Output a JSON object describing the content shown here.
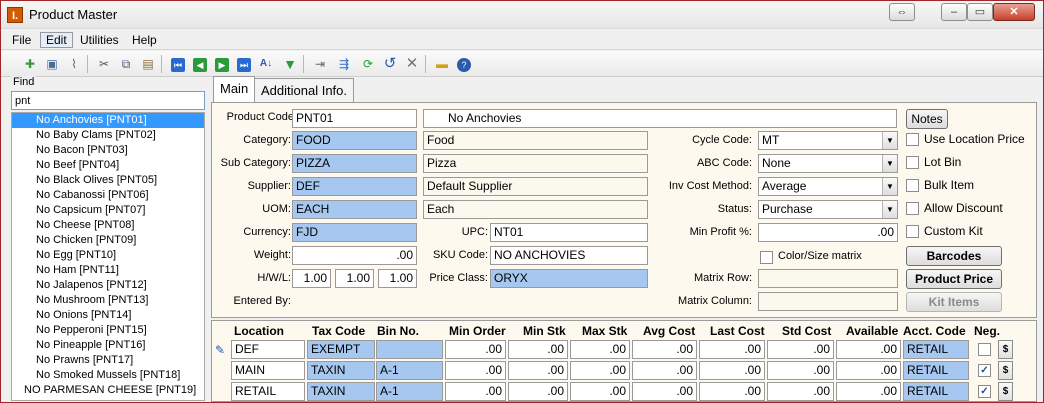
{
  "window": {
    "title": "Product Master",
    "app_icon": "I."
  },
  "menu": [
    "File",
    "Edit",
    "Utilities",
    "Help"
  ],
  "find": {
    "label": "Find",
    "query": "pnt",
    "items": [
      "No Anchovies [PNT01]",
      "No Baby Clams [PNT02]",
      "No Bacon [PNT03]",
      "No Beef [PNT04]",
      "No Black Olives [PNT05]",
      "No Cabanossi [PNT06]",
      "No Capsicum [PNT07]",
      "No Cheese [PNT08]",
      "No Chicken [PNT09]",
      "No Egg [PNT10]",
      "No Ham [PNT11]",
      "No Jalapenos [PNT12]",
      "No Mushroom [PNT13]",
      "No Onions [PNT14]",
      "No Pepperoni [PNT15]",
      "No Pineapple [PNT16]",
      "No Prawns [PNT17]",
      "No Smoked Mussels [PNT18]",
      "NO PARMESAN CHEESE [PNT19]"
    ]
  },
  "tabs": [
    "Main",
    "Additional Info."
  ],
  "form": {
    "product_code_label": "Product Code:",
    "product_code": "PNT01",
    "description": "No Anchovies",
    "notes_button": "Notes",
    "category_label": "Category:",
    "category_code": "FOOD",
    "category_name": "Food",
    "subcategory_label": "Sub Category:",
    "subcategory_code": "PIZZA",
    "subcategory_name": "Pizza",
    "supplier_label": "Supplier:",
    "supplier_code": "DEF",
    "supplier_name": "Default Supplier",
    "uom_label": "UOM:",
    "uom_code": "EACH",
    "uom_name": "Each",
    "currency_label": "Currency:",
    "currency_code": "FJD",
    "upc_label": "UPC:",
    "upc": "NT01",
    "weight_label": "Weight:",
    "weight": ".00",
    "sku_label": "SKU Code:",
    "sku": "NO ANCHOVIES",
    "hwl_label": "H/W/L:",
    "h": "1.00",
    "w": "1.00",
    "l": "1.00",
    "price_class_label": "Price Class:",
    "price_class": "ORYX",
    "entered_by_label": "Entered By:",
    "cycle_code_label": "Cycle Code:",
    "cycle_code": "MT",
    "abc_code_label": "ABC Code:",
    "abc_code": "None",
    "inv_cost_label": "Inv Cost Method:",
    "inv_cost": "Average",
    "status_label": "Status:",
    "status": "Purchase",
    "min_profit_label": "Min Profit %:",
    "min_profit": ".00",
    "color_size_label": "Color/Size matrix",
    "matrix_row_label": "Matrix Row:",
    "matrix_column_label": "Matrix Column:",
    "use_location_price_label": "Use Location Price",
    "lot_bin_label": "Lot Bin",
    "bulk_item_label": "Bulk Item",
    "allow_discount_label": "Allow Discount",
    "custom_kit_label": "Custom Kit",
    "barcodes_button": "Barcodes",
    "product_price_button": "Product Price",
    "kit_items_button": "Kit Items"
  },
  "grid": {
    "headers": [
      "Location",
      "Tax Code",
      "Bin No.",
      "Min Order",
      "Min Stk",
      "Max Stk",
      "Avg Cost",
      "Last Cost",
      "Std Cost",
      "Available",
      "Acct. Code",
      "Neg."
    ],
    "rows": [
      {
        "location": "DEF",
        "tax": "EXEMPT",
        "bin": "",
        "min_order": ".00",
        "min_stk": ".00",
        "max_stk": ".00",
        "avg": ".00",
        "last": ".00",
        "std": ".00",
        "avail": ".00",
        "acct": "RETAIL",
        "neg": false,
        "dollar": "$"
      },
      {
        "location": "MAIN",
        "tax": "TAXIN",
        "bin": "A-1",
        "min_order": ".00",
        "min_stk": ".00",
        "max_stk": ".00",
        "avg": ".00",
        "last": ".00",
        "std": ".00",
        "avail": ".00",
        "acct": "RETAIL",
        "neg": true,
        "dollar": "$"
      },
      {
        "location": "RETAIL",
        "tax": "TAXIN",
        "bin": "A-1",
        "min_order": ".00",
        "min_stk": ".00",
        "max_stk": ".00",
        "avg": ".00",
        "last": ".00",
        "std": ".00",
        "avail": ".00",
        "acct": "RETAIL",
        "neg": true,
        "dollar": "$"
      }
    ]
  },
  "colors": {
    "accent_field": "#a6c8f0",
    "selected": "#3399ff",
    "panel": "#fdf9ef"
  }
}
